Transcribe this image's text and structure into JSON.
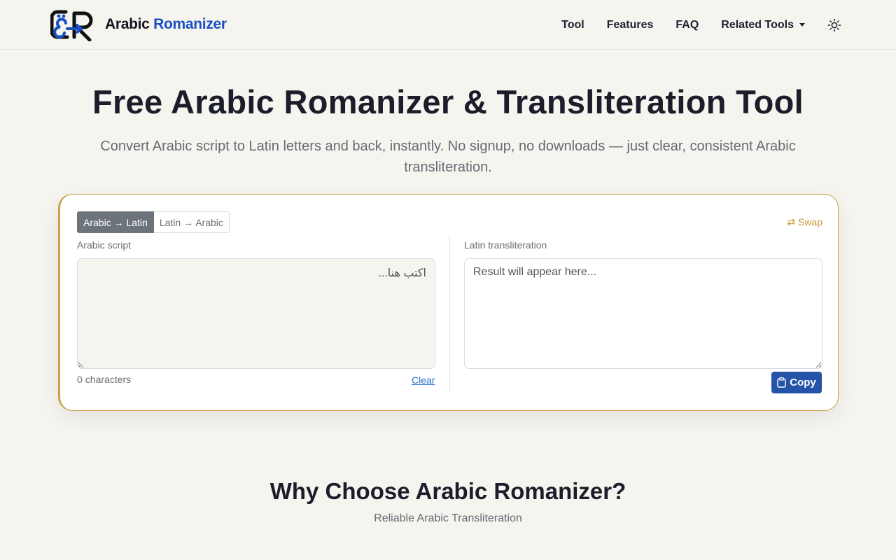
{
  "brand": {
    "word1": "Arabic",
    "word2": "Romanizer"
  },
  "nav": {
    "items": [
      {
        "label": "Tool"
      },
      {
        "label": "Features"
      },
      {
        "label": "FAQ"
      },
      {
        "label": "Related Tools"
      }
    ],
    "theme_icon": "sun-icon"
  },
  "hero": {
    "title": "Free Arabic Romanizer & Transliteration Tool",
    "subtitle": "Convert Arabic script to Latin letters and back, instantly. No signup, no downloads — just clear, consistent Arabic transliteration."
  },
  "tool": {
    "modes": [
      {
        "label": "Arabic → Latin",
        "active": true
      },
      {
        "label": "Latin → Arabic",
        "active": false
      }
    ],
    "swap_label": "⇄ Swap",
    "input": {
      "label": "Arabic script",
      "placeholder": "اكتب هنا...",
      "value": ""
    },
    "output": {
      "label": "Latin transliteration",
      "placeholder": "Result will appear here...",
      "value": ""
    },
    "char_count": "0",
    "char_count_suffix": "characters",
    "clear_label": "Clear",
    "copy_label": "Copy"
  },
  "why": {
    "title": "Why Choose Arabic Romanizer?",
    "subtitle": "Reliable Arabic Transliteration"
  },
  "colors": {
    "accent_gold": "#c9a24a",
    "primary_blue": "#2553a8",
    "brand_blue": "#1a4fc4",
    "background": "#f5f4ef"
  }
}
